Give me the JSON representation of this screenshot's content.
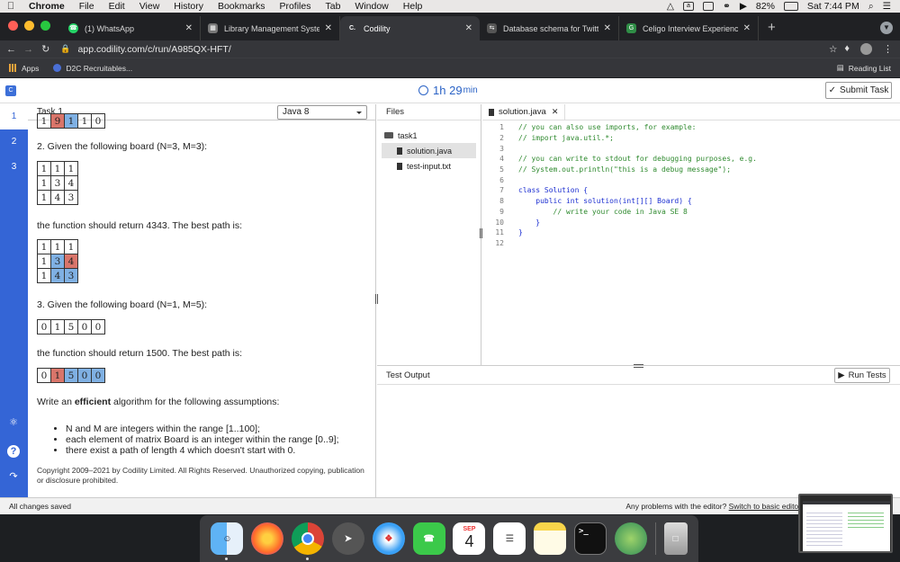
{
  "menubar": {
    "app": "Chrome",
    "items": [
      "File",
      "Edit",
      "View",
      "History",
      "Bookmarks",
      "Profiles",
      "Tab",
      "Window",
      "Help"
    ],
    "battery": "82%",
    "clock": "Sat 7:44 PM"
  },
  "tabs": [
    {
      "title": "(1) WhatsApp",
      "color": "#25d366"
    },
    {
      "title": "Library Management System D",
      "color": "#777777"
    },
    {
      "title": "Codility",
      "color": "#35363a",
      "active": true
    },
    {
      "title": "Database schema for Twitter -",
      "color": "#888888"
    },
    {
      "title": "Celigo Interview Experience | G",
      "color": "#2f8d46"
    }
  ],
  "address": {
    "url": "app.codility.com/c/run/A985QX-HFT/"
  },
  "bookmarks": {
    "apps": "Apps",
    "d2c": "D2C Recruitables...",
    "reading_list": "Reading List"
  },
  "app": {
    "timer_hours": "1h",
    "timer_minutes": "29",
    "timer_unit": "min",
    "submit_label": "Submit Task",
    "task_numbers": [
      "1",
      "2",
      "3"
    ],
    "task_title": "Task 1",
    "language": "Java 8",
    "task_text": {
      "ex2": "2. Given the following board (N=3, M=3):",
      "ex2_result": "the function should return 4343. The best path is:",
      "ex3": "3. Given the following board (N=1, M=5):",
      "ex3_result": "the function should return 1500. The best path is:",
      "assume_pre": "Write an ",
      "assume_bold": "efficient",
      "assume_post": " algorithm for the following assumptions:",
      "bullets": [
        "N and M are integers within the range [1..100];",
        "each element of matrix Board is an integer within the range [0..9];",
        "there exist a path of length 4 which doesn't start with 0."
      ],
      "copyright": "Copyright 2009–2021 by Codility Limited. All Rights Reserved. Unauthorized copying, publication or disclosure prohibited."
    },
    "top_partial_row": [
      "1",
      "9",
      "1",
      "1",
      "0"
    ],
    "board2": [
      [
        "1",
        "1",
        "1"
      ],
      [
        "1",
        "3",
        "4"
      ],
      [
        "1",
        "4",
        "3"
      ]
    ],
    "board2_path": [
      [
        "1",
        "1",
        "1"
      ],
      [
        "1",
        "3",
        "4"
      ],
      [
        "1",
        "4",
        "3"
      ]
    ],
    "board3": [
      "0",
      "1",
      "5",
      "0",
      "0"
    ],
    "board3_path": [
      "0",
      "1",
      "5",
      "0",
      "0"
    ],
    "files_header": "Files",
    "folder": "task1",
    "files": [
      "solution.java",
      "test-input.txt"
    ],
    "editor_tab": "solution.java",
    "code_lines": [
      "// you can also use imports, for example:",
      "// import java.util.*;",
      "",
      "// you can write to stdout for debugging purposes, e.g.",
      "// System.out.println(\"this is a debug message\");",
      "",
      "class Solution {",
      "    public int solution(int[][] Board) {",
      "        // write your code in Java SE 8",
      "    }",
      "}",
      ""
    ],
    "output_header": "Test Output",
    "run_tests": "Run Tests",
    "status_left": "All changes saved",
    "status_right_pre": "Any problems with the editor? ",
    "status_right_link": "Switch to basic editor"
  },
  "dock": {
    "calendar_month": "SEP",
    "calendar_day": "4"
  }
}
